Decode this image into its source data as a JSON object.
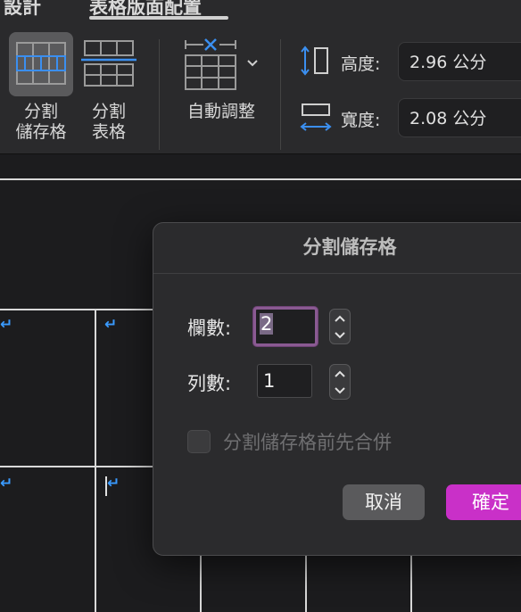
{
  "ribbon": {
    "tabs": [
      {
        "label": "設計"
      },
      {
        "label": "表格版面配置"
      }
    ],
    "split_cells_label_1": "分割",
    "split_cells_label_2": "儲存格",
    "split_table_label_1": "分割",
    "split_table_label_2": "表格",
    "autofit_label": "自動調整",
    "height_label": "高度:",
    "height_value": "2.96 公分",
    "width_label": "寬度:",
    "width_value": "2.08 公分"
  },
  "dialog": {
    "title": "分割儲存格",
    "columns_label": "欄數:",
    "columns_value": "2",
    "rows_label": "列數:",
    "rows_value": "1",
    "merge_label": "分割儲存格前先合併",
    "merge_checked": false,
    "cancel_label": "取消",
    "ok_label": "確定"
  },
  "document": {
    "paragraph_mark": "↵"
  },
  "colors": {
    "accent": "#c930c8",
    "focus_ring": "#8a5a92",
    "paragraph_mark": "#3a9bff"
  }
}
